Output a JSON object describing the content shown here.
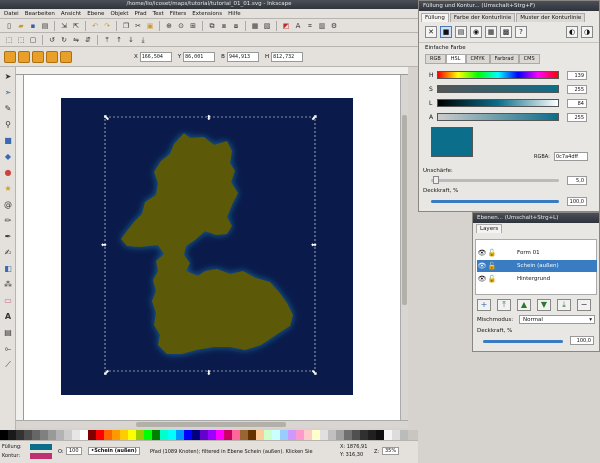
{
  "window": {
    "title": "/home/lio/icoset/maps/tutorial/tutorial_01_01.svg - Inkscape"
  },
  "menu": [
    "Datei",
    "Bearbeiten",
    "Ansicht",
    "Ebene",
    "Objekt",
    "Pfad",
    "Text",
    "Filters",
    "Extensions",
    "Hilfe"
  ],
  "coords": {
    "x_label": "X",
    "x_value": "166,504",
    "y_label": "Y",
    "y_value": "86,001",
    "w_label": "B",
    "w_value": "944,913",
    "h_label": "H",
    "h_value": "812,732"
  },
  "fill_panel": {
    "title": "Füllung und Kontur... (Umschalt+Strg+F)",
    "tabs": [
      "Füllung",
      "Farbe der Konturlinie",
      "Muster der Konturlinie"
    ],
    "section_label": "Einfache Farbe",
    "color_tabs": [
      "RGB",
      "HSL",
      "CMYK",
      "Farbrad",
      "CMS"
    ],
    "sliders": [
      {
        "label": "H",
        "value": "139"
      },
      {
        "label": "S",
        "value": "255"
      },
      {
        "label": "L",
        "value": "84"
      },
      {
        "label": "A",
        "value": "255"
      }
    ],
    "rgba_label": "RGBA:",
    "rgba_value": "0c7a4dff",
    "blur_label": "Unschärfe:",
    "blur_value": "5,0",
    "opacity_label": "Deckkraft, %",
    "opacity_value": "100,0",
    "colors": {
      "h_hue": "#00a0c0",
      "s_sat": "#0b6e8a",
      "l_dark": "#062a40",
      "a_alpha": "#0b6e8a"
    }
  },
  "layers_panel": {
    "title": "Ebenen... (Umschalt+Strg+L)",
    "tab": "Layers",
    "layers": [
      "Form 01",
      "Schein (außen)",
      "Hintergrund"
    ],
    "blend_label": "Mischmodus:",
    "blend_value": "Normal",
    "opacity_label": "Deckkraft, %",
    "opacity_value": "100,0"
  },
  "canvas": {
    "background": "#0a1a4a",
    "island": "#5c5a08",
    "glow": "#1a6a9a"
  },
  "status": {
    "fill_label": "Füllung:",
    "stroke_label": "Kontur:",
    "opacity_label": "O:",
    "opacity_value": "100",
    "layer_value": "•Schein (außen)",
    "message": "Pfad (1089 Knoten); filtered in Ebene Schein (außen). Klicken Sie",
    "cursor_x": "X: 1876,91",
    "cursor_y": "Y: 316,30",
    "zoom_label": "Z:",
    "zoom_value": "35%"
  },
  "palette": [
    "#000000",
    "#1a1a1a",
    "#333333",
    "#4d4d4d",
    "#666666",
    "#808080",
    "#999999",
    "#b3b3b3",
    "#cccccc",
    "#e6e6e6",
    "#ffffff",
    "#800000",
    "#ff0000",
    "#ff6600",
    "#ff9900",
    "#ffcc00",
    "#ffff00",
    "#99cc00",
    "#00ff00",
    "#008000",
    "#00ffcc",
    "#00ffff",
    "#0099ff",
    "#0000ff",
    "#000080",
    "#6600cc",
    "#9900ff",
    "#ff00ff",
    "#cc0066",
    "#ff6699",
    "#996633",
    "#663300",
    "#ffcc99",
    "#ccffcc",
    "#ccffff",
    "#99ccff",
    "#cc99ff",
    "#ff99cc",
    "#ffcccc",
    "#ffffcc",
    "#e0e0e0",
    "#c0c0c0",
    "#a0a0a0",
    "#707070",
    "#505050",
    "#303030",
    "#202020",
    "#101010",
    "#f5f5f5",
    "#dddddd",
    "#bbbbbb"
  ]
}
